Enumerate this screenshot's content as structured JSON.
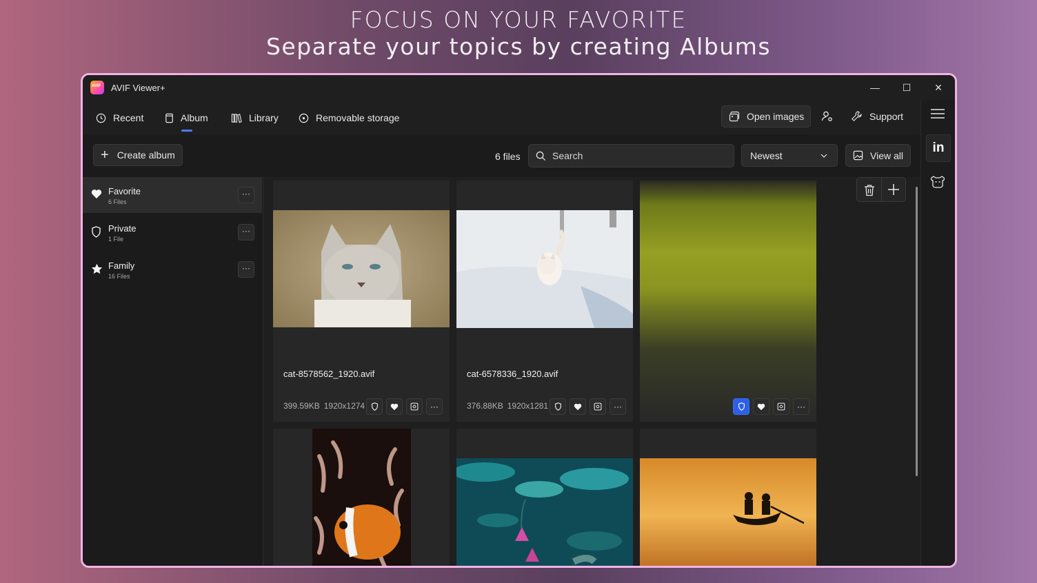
{
  "promo": {
    "line1": "FOCUS ON YOUR FAVORITE",
    "line2": "Separate your topics by creating Albums"
  },
  "window": {
    "title": "AVIF Viewer+",
    "controls": {
      "minimize": "—",
      "maximize": "☐",
      "close": "✕"
    }
  },
  "nav": {
    "recent": "Recent",
    "album": "Album",
    "library": "Library",
    "removable": "Removable storage",
    "open_images": "Open images",
    "support": "Support"
  },
  "toolbar": {
    "create_album": "Create album",
    "file_count": "6 files",
    "search_placeholder": "Search",
    "sort_value": "Newest",
    "view_all": "View all"
  },
  "albums": [
    {
      "name": "Favorite",
      "count": "6 Files",
      "icon": "heart-icon"
    },
    {
      "name": "Private",
      "count": "1 File",
      "icon": "shield-icon"
    },
    {
      "name": "Family",
      "count": "16 Files",
      "icon": "star-icon"
    }
  ],
  "more_label": "···",
  "cards": [
    {
      "name": "cat-8578562_1920.avif",
      "size": "399.59KB",
      "dims": "1920x1274"
    },
    {
      "name": "cat-6578336_1920.avif",
      "size": "376.88KB",
      "dims": "1920x1281"
    }
  ],
  "colors": {
    "accent": "#2f5fe8",
    "window_border": "#f0b4e4"
  }
}
